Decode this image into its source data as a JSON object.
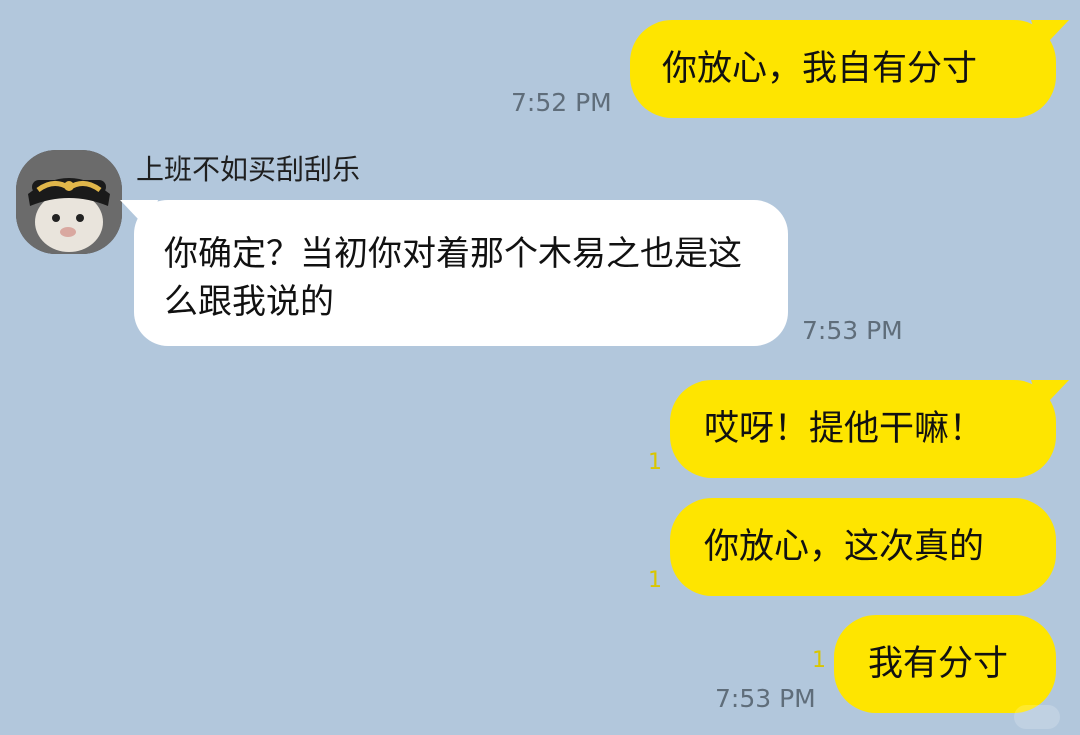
{
  "messages": {
    "m1": {
      "text": "你放心，我自有分寸",
      "time": "7:52 PM"
    },
    "m2": {
      "sender": "上班不如买刮刮乐",
      "text": "你确定？当初你对着那个木易之也是这么跟我说的",
      "time": "7:53 PM"
    },
    "m3": {
      "text": "哎呀！提他干嘛！",
      "unread": "1"
    },
    "m4": {
      "text": "你放心，这次真的",
      "unread": "1"
    },
    "m5": {
      "text": "我有分寸",
      "unread": "1",
      "time": "7:53 PM"
    }
  },
  "icons": {
    "avatar": "cat-in-cap-avatar-icon"
  },
  "colors": {
    "background": "#b2c7dc",
    "outgoing_bubble": "#fee500",
    "incoming_bubble": "#ffffff",
    "unread_count": "#d9c600",
    "timestamp": "#5f6d7a"
  }
}
